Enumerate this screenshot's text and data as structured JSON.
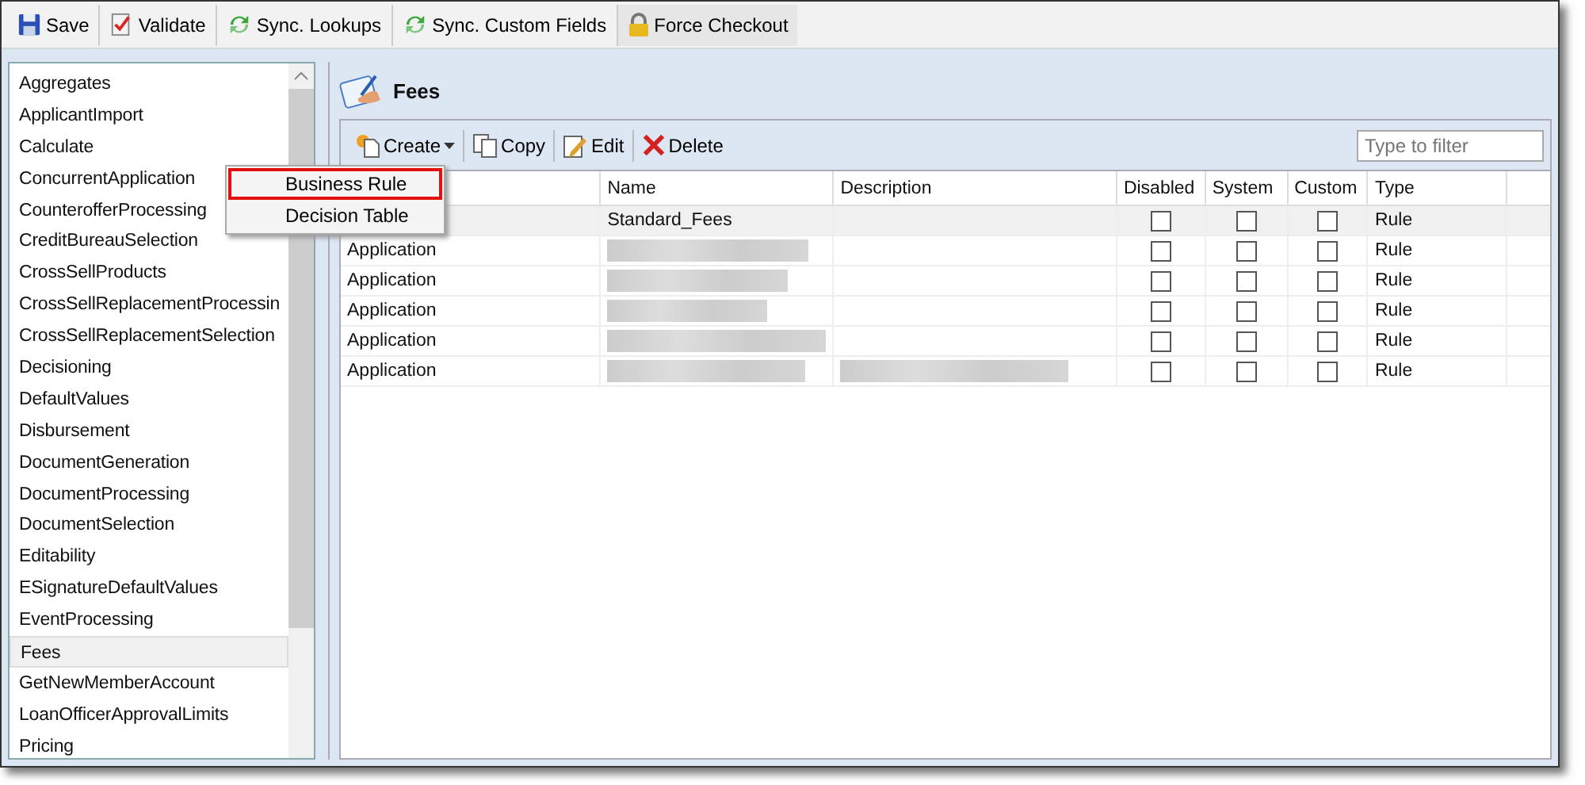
{
  "toolbar": [
    {
      "label": "Save"
    },
    {
      "label": "Validate"
    },
    {
      "label": "Sync. Lookups"
    },
    {
      "label": "Sync. Custom Fields"
    },
    {
      "label": "Force Checkout"
    }
  ],
  "sidebar": {
    "items": [
      {
        "label": "Aggregates",
        "selected": false
      },
      {
        "label": "ApplicantImport",
        "selected": false
      },
      {
        "label": "Calculate",
        "selected": false
      },
      {
        "label": "ConcurrentApplication",
        "selected": false
      },
      {
        "label": "CounterofferProcessing",
        "selected": false
      },
      {
        "label": "CreditBureauSelection",
        "selected": false
      },
      {
        "label": "CrossSellProducts",
        "selected": false
      },
      {
        "label": "CrossSellReplacementProcessin",
        "selected": false
      },
      {
        "label": "CrossSellReplacementSelection",
        "selected": false
      },
      {
        "label": "Decisioning",
        "selected": false
      },
      {
        "label": "DefaultValues",
        "selected": false
      },
      {
        "label": "Disbursement",
        "selected": false
      },
      {
        "label": "DocumentGeneration",
        "selected": false
      },
      {
        "label": "DocumentProcessing",
        "selected": false
      },
      {
        "label": "DocumentSelection",
        "selected": false
      },
      {
        "label": "Editability",
        "selected": false
      },
      {
        "label": "ESignatureDefaultValues",
        "selected": false
      },
      {
        "label": "EventProcessing",
        "selected": false
      },
      {
        "label": "Fees",
        "selected": true
      },
      {
        "label": "GetNewMemberAccount",
        "selected": false
      },
      {
        "label": "LoanOfficerApprovalLimits",
        "selected": false
      },
      {
        "label": "Pricing",
        "selected": false
      }
    ]
  },
  "panel": {
    "title": "Fees",
    "actions": [
      {
        "label": "Create",
        "dropdown": true
      },
      {
        "label": "Copy",
        "dropdown": false
      },
      {
        "label": "Edit",
        "dropdown": false
      },
      {
        "label": "Delete",
        "dropdown": false
      }
    ],
    "filter": {
      "placeholder": "Type to filter"
    },
    "menu": [
      {
        "label": "Business Rule",
        "highlighted": true
      },
      {
        "label": "Decision Table",
        "highlighted": false
      }
    ],
    "table": {
      "columns": [
        "Name",
        "Description",
        "Disabled",
        "System",
        "Custom",
        "Type"
      ],
      "rows": [
        {
          "selected": true,
          "name": "Standard_Fees",
          "name_blurred": false,
          "description_blurred": false,
          "disabled": false,
          "system": false,
          "custom": false,
          "type": "Rule"
        },
        {
          "selected": false,
          "category": "Application",
          "name_blurred": true,
          "description_blurred": false,
          "disabled": false,
          "system": false,
          "custom": false,
          "type": "Rule"
        },
        {
          "selected": false,
          "category": "Application",
          "name_blurred": true,
          "description_blurred": false,
          "disabled": false,
          "system": false,
          "custom": false,
          "type": "Rule"
        },
        {
          "selected": false,
          "category": "Application",
          "name_blurred": true,
          "description_blurred": false,
          "disabled": false,
          "system": false,
          "custom": false,
          "type": "Rule"
        },
        {
          "selected": false,
          "category": "Application",
          "name_blurred": true,
          "description_blurred": false,
          "disabled": false,
          "system": false,
          "custom": false,
          "type": "Rule"
        },
        {
          "selected": false,
          "category": "Application",
          "name_blurred": true,
          "description_blurred": true,
          "disabled": false,
          "system": false,
          "custom": false,
          "type": "Rule"
        }
      ]
    }
  }
}
